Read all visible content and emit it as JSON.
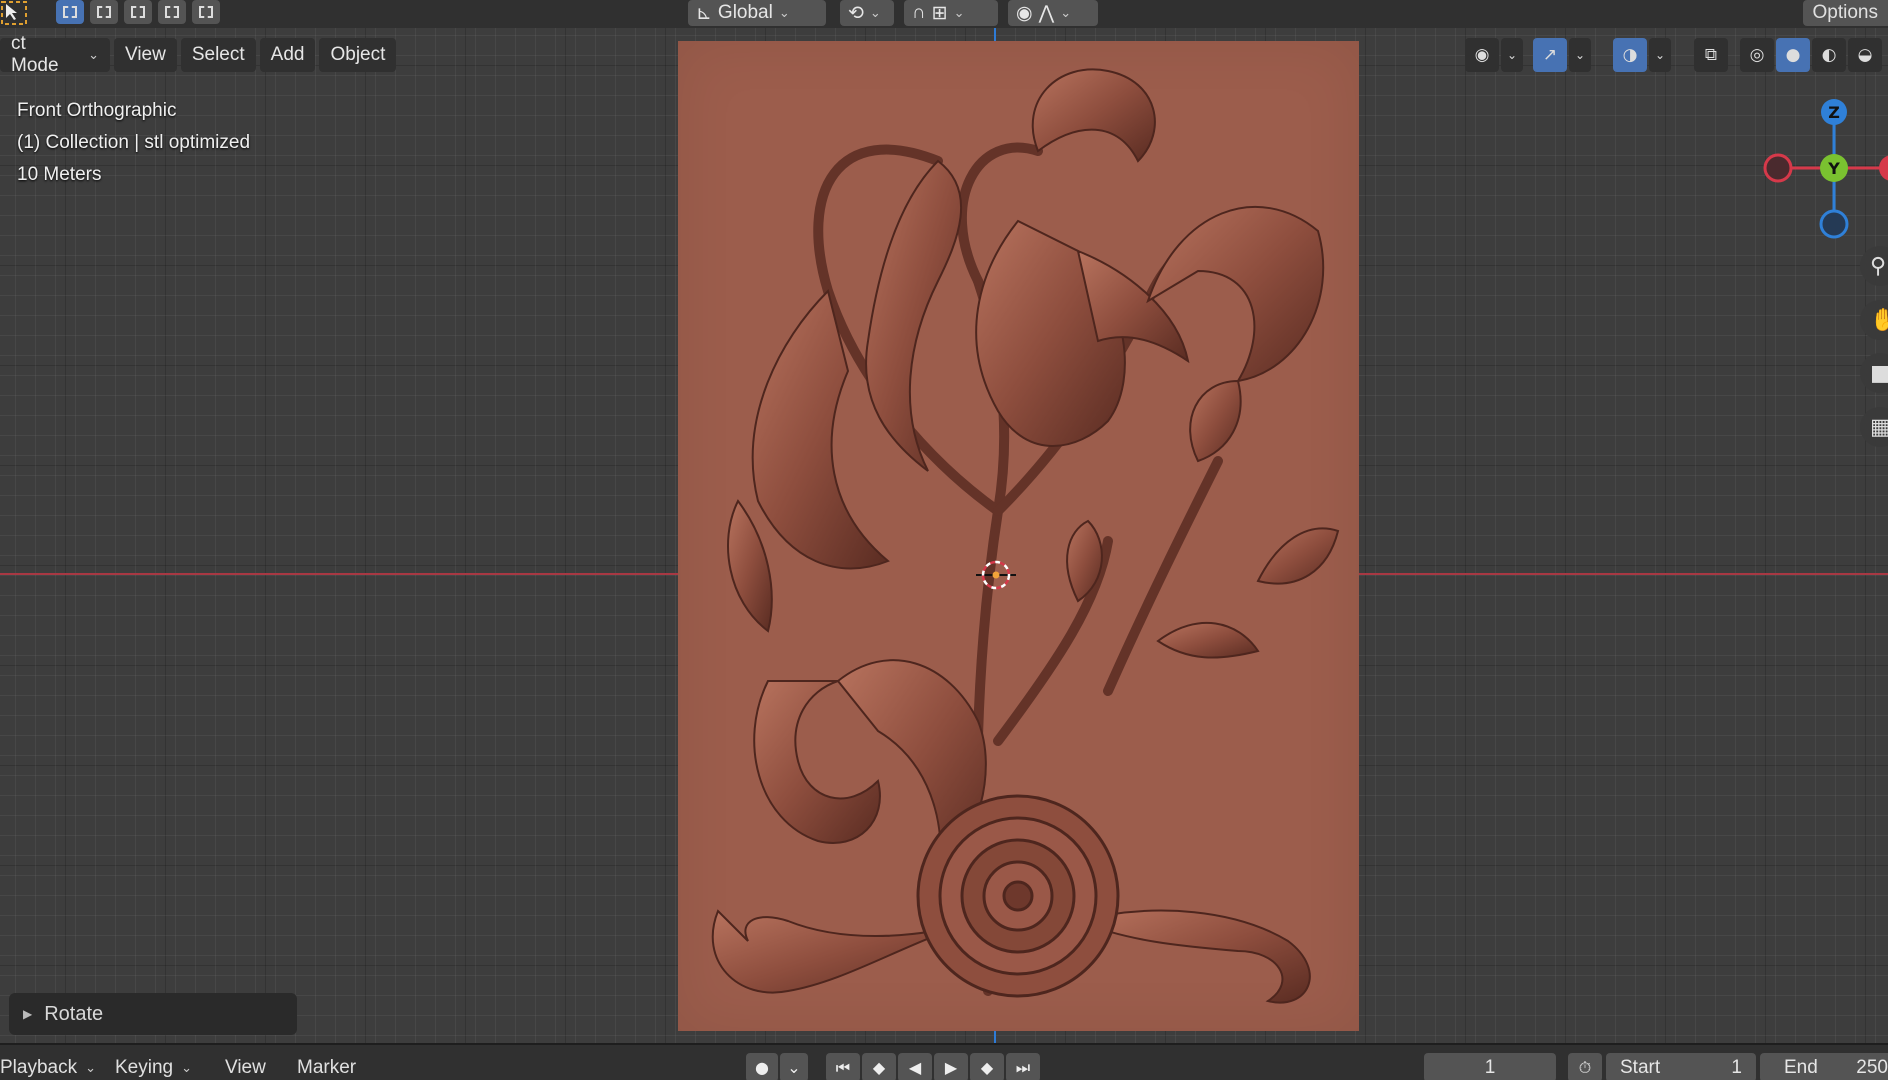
{
  "header": {
    "transform_orientation": "Global",
    "options_label": "Options"
  },
  "menus": {
    "mode": "ct Mode",
    "view": "View",
    "select": "Select",
    "add": "Add",
    "object": "Object"
  },
  "viewport_info": {
    "view_name": "Front Orthographic",
    "collection": "(1) Collection | stl optimized",
    "scale": "10 Meters"
  },
  "gizmo": {
    "z_label": "Z",
    "y_label": "Y",
    "x_color": "#d6394a",
    "y_color": "#7ac130",
    "z_color": "#2f80d8"
  },
  "last_operator": {
    "label": "Rotate"
  },
  "timeline": {
    "playback": "Playback",
    "keying": "Keying",
    "view": "View",
    "marker": "Marker",
    "current_frame": "1",
    "start_label": "Start",
    "start_value": "1",
    "end_label": "End",
    "end_value": "250"
  },
  "colors": {
    "accent": "#4772b3",
    "panel": "#9c5d4c",
    "x_axis_line": "#a83843"
  },
  "icons": {
    "nav": [
      "zoom-icon",
      "hand-pan-icon",
      "camera-icon",
      "grid-icon"
    ]
  }
}
